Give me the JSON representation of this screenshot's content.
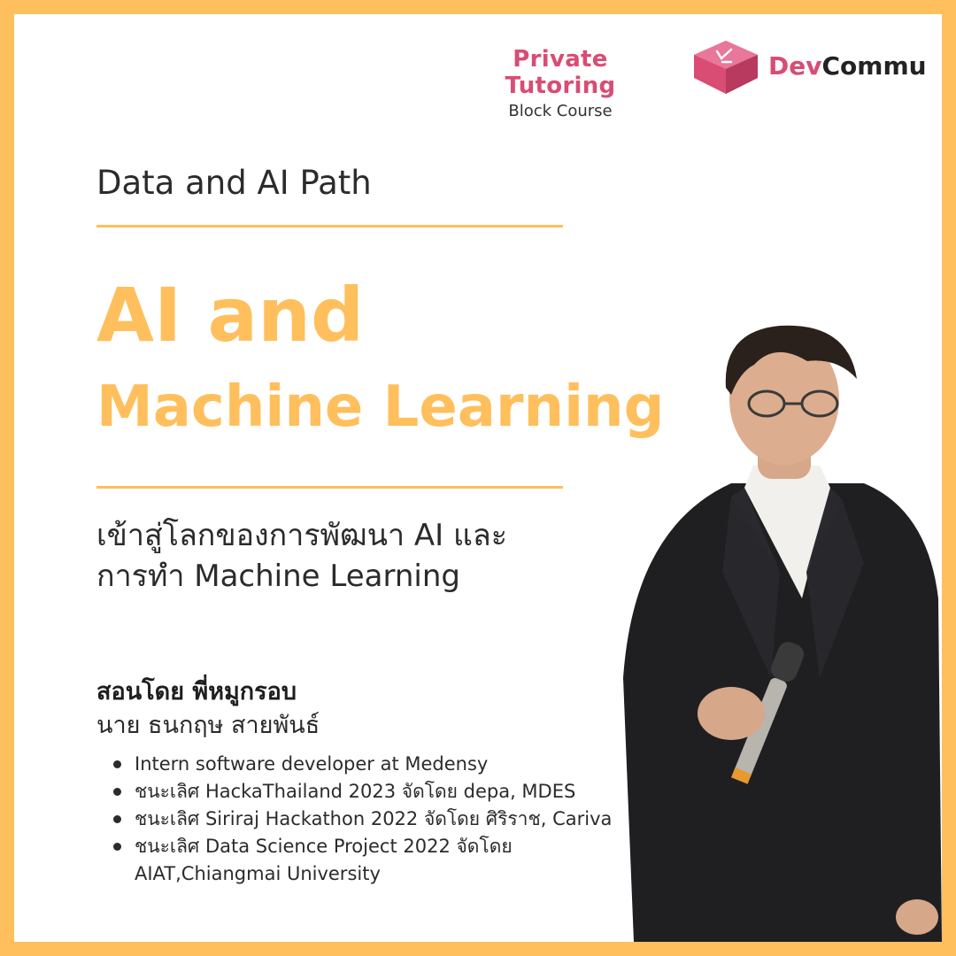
{
  "brand": {
    "course_title": "Private Tutoring",
    "course_subtitle": "Block Course",
    "logo_part1": "Dev",
    "logo_part2": "Commu",
    "pink": "#D94C73"
  },
  "path_title": "Data and AI Path",
  "headline": {
    "line1": "AI and",
    "line2": "Machine Learning",
    "color": "#FFBF5C"
  },
  "subtitle": {
    "line1": "เข้าสู่โลกของการพัฒนา AI และ",
    "line2": "การทำ Machine Learning"
  },
  "teacher": {
    "label": "สอนโดย พี่หมูกรอบ",
    "full_name": "นาย ธนกฤษ สายพันธ์"
  },
  "credentials": [
    "Intern software developer at Medensy",
    "ชนะเลิศ HackaThailand 2023 จัดโดย depa, MDES",
    "ชนะเลิศ Siriraj Hackathon 2022 จัดโดย ศิริราช, Cariva",
    "ชนะเลิศ Data Science Project 2022 จัดโดย AIAT,Chiangmai University"
  ],
  "photo": {
    "icon": "presenter-photo"
  }
}
